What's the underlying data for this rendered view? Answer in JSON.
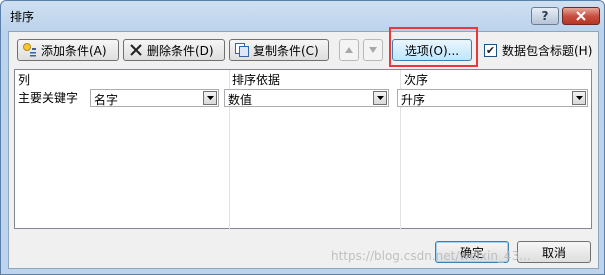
{
  "window": {
    "title": "排序"
  },
  "caption_buttons": {
    "help": "?"
  },
  "toolbar": {
    "add_label": "添加条件(A)",
    "delete_label": "删除条件(D)",
    "copy_label": "复制条件(C)",
    "options_label": "选项(O)...",
    "header_checkbox_label": "数据包含标题(H)",
    "header_checkbox_checked": true
  },
  "grid": {
    "headers": {
      "column": "列",
      "sort_on": "排序依据",
      "order": "次序"
    },
    "rows": [
      {
        "label": "主要关键字",
        "column": "名字",
        "sort_on": "数值",
        "order": "升序"
      }
    ]
  },
  "footer": {
    "ok": "确定",
    "cancel": "取消"
  },
  "watermark": "https://blog.csdn.net/weixin_43...",
  "colors": {
    "highlight": "#e8383d",
    "titlebar": "#bcd3ec"
  }
}
